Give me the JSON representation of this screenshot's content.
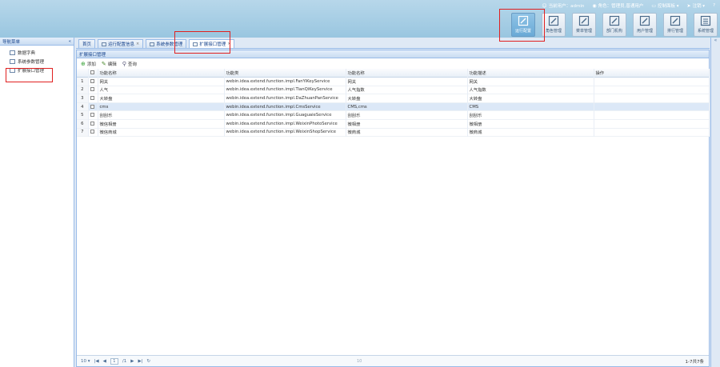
{
  "header": {
    "status_items": [
      {
        "icon": "user-icon",
        "label": "当前用户：admin"
      },
      {
        "icon": "role-icon",
        "label": "角色：管理员,普通用户"
      },
      {
        "icon": "monitor-icon",
        "label": "控制面板 ▾"
      },
      {
        "icon": "logout-icon",
        "label": "注销 ▾"
      },
      {
        "icon": "help-icon",
        "label": "?"
      }
    ],
    "tiles": [
      {
        "label": "运行配置",
        "active": true
      },
      {
        "label": "角色管理",
        "active": false
      },
      {
        "label": "菜单管理",
        "active": false
      },
      {
        "label": "部门机构",
        "active": false
      },
      {
        "label": "用户管理",
        "active": false
      },
      {
        "label": "排行管理",
        "active": false
      },
      {
        "label": "系统管理",
        "active": false
      }
    ]
  },
  "sidebar": {
    "title": "导航菜单",
    "collapse_glyph": "«",
    "items": [
      {
        "label": "数据字典"
      },
      {
        "label": "系统参数管理"
      },
      {
        "label": "扩展接口管理"
      }
    ]
  },
  "tabs": [
    {
      "label": "首页",
      "closable": false,
      "icon": false,
      "active": false
    },
    {
      "label": "运行配置信息",
      "closable": true,
      "icon": true,
      "active": false
    },
    {
      "label": "系统参数管理",
      "closable": false,
      "icon": true,
      "active": false
    },
    {
      "label": "扩展接口管理",
      "closable": true,
      "icon": true,
      "active": true
    }
  ],
  "panel": {
    "title": "扩展接口管理",
    "actions": [
      {
        "icon": "add-icon",
        "label": "添加"
      },
      {
        "icon": "edit-icon",
        "label": "编辑"
      },
      {
        "icon": "search-icon",
        "label": "查询"
      }
    ]
  },
  "grid": {
    "columns": [
      "功能名称",
      "功能类",
      "功能名称",
      "功能描述",
      "操作"
    ],
    "rows": [
      {
        "n": "1",
        "name": "网关",
        "cls": "webin.idea.extend.function.impl.FanYiKeyService",
        "alias": "网关",
        "desc": "网关",
        "selected": false
      },
      {
        "n": "2",
        "name": "人气",
        "cls": "webin.idea.extend.function.impl.TianQiKeyService",
        "alias": "人气指数",
        "desc": "人气指数",
        "selected": false
      },
      {
        "n": "3",
        "name": "大转盘",
        "cls": "webin.idea.extend.function.impl.DaZhuanPanService",
        "alias": "大转盘",
        "desc": "大转盘",
        "selected": false
      },
      {
        "n": "4",
        "name": "cms",
        "cls": "webin.idea.extend.function.impl.CmsService",
        "alias": "CMS,cms",
        "desc": "CMS",
        "selected": true
      },
      {
        "n": "5",
        "name": "刮刮乐",
        "cls": "webin.idea.extend.function.impl.GuaguaieService",
        "alias": "刮刮乐",
        "desc": "刮刮乐",
        "selected": false
      },
      {
        "n": "6",
        "name": "微信相册",
        "cls": "webin.idea.extend.function.impl.WeixinPhotoService",
        "alias": "微相册",
        "desc": "微相册",
        "selected": false
      },
      {
        "n": "7",
        "name": "微信商城",
        "cls": "webin.idea.extend.function.impl.WeixinShopService",
        "alias": "微商城",
        "desc": "微商城",
        "selected": false
      }
    ]
  },
  "pager": {
    "page_size": "10 ▾",
    "first": "|◀",
    "prev": "◀",
    "page": "1",
    "total_pages": "/1",
    "next": "▶",
    "last": "▶|",
    "refresh": "↻",
    "summary": "1-7共7条"
  },
  "right_strip": {
    "glyph": "«"
  },
  "footer": {
    "mark": "10"
  }
}
